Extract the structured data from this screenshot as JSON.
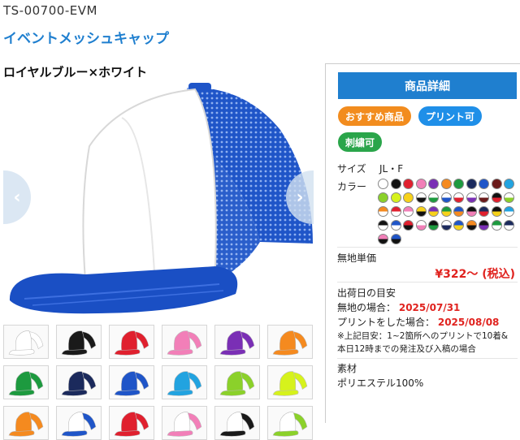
{
  "product": {
    "code": "TS-00700-EVM",
    "name": "イベントメッシュキャップ",
    "variant": "ロイヤルブルー×ホワイト"
  },
  "gallery": {
    "prev_icon": "chevron-left-icon",
    "next_icon": "chevron-right-icon",
    "prev_glyph": "‹",
    "next_glyph": "›",
    "thumbnails": [
      {
        "front": "#ffffff",
        "back": "#ffffff",
        "brim": "#ffffff"
      },
      {
        "front": "#1a1a1a",
        "back": "#1a1a1a",
        "brim": "#1a1a1a"
      },
      {
        "front": "#e0202e",
        "back": "#e0202e",
        "brim": "#e0202e"
      },
      {
        "front": "#f27fb8",
        "back": "#f27fb8",
        "brim": "#f27fb8"
      },
      {
        "front": "#7a2fb5",
        "back": "#7a2fb5",
        "brim": "#7a2fb5"
      },
      {
        "front": "#f58a1f",
        "back": "#f58a1f",
        "brim": "#f58a1f"
      },
      {
        "front": "#1d9a3f",
        "back": "#1d9a3f",
        "brim": "#1d9a3f"
      },
      {
        "front": "#1b2a5c",
        "back": "#1b2a5c",
        "brim": "#1b2a5c"
      },
      {
        "front": "#1f55c8",
        "back": "#1f55c8",
        "brim": "#1f55c8"
      },
      {
        "front": "#22a3e0",
        "back": "#22a3e0",
        "brim": "#22a3e0"
      },
      {
        "front": "#8bd12a",
        "back": "#8bd12a",
        "brim": "#8bd12a"
      },
      {
        "front": "#d6f21c",
        "back": "#d6f21c",
        "brim": "#d6f21c"
      },
      {
        "front": "#f58a1f",
        "back": "#f58a1f",
        "brim": "#f58a1f"
      },
      {
        "front": "#ffffff",
        "back": "#1f55c8",
        "brim": "#1f55c8"
      },
      {
        "front": "#e0202e",
        "back": "#e0202e",
        "brim": "#e0202e"
      },
      {
        "front": "#ffffff",
        "back": "#f27fb8",
        "brim": "#f27fb8"
      },
      {
        "front": "#ffffff",
        "back": "#1a1a1a",
        "brim": "#1a1a1a"
      },
      {
        "front": "#ffffff",
        "back": "#8bd12a",
        "brim": "#8bd12a"
      }
    ]
  },
  "hero": {
    "front": "#ffffff",
    "mesh": "#1f55c8",
    "brim": "#1a4fc4"
  },
  "details": {
    "header": "商品詳細",
    "tags": {
      "recommended": "おすすめ商品",
      "printable": "プリント可",
      "embroidery": "刺繍可"
    },
    "size_label": "サイズ",
    "size_value": "JL・F",
    "color_label": "カラー",
    "colors": [
      [
        "#ffffff",
        "#ffffff"
      ],
      [
        "#111111",
        "#111111"
      ],
      [
        "#e0202e",
        "#e0202e"
      ],
      [
        "#f27fb8",
        "#f27fb8"
      ],
      [
        "#7a2fb5",
        "#7a2fb5"
      ],
      [
        "#f58a1f",
        "#f58a1f"
      ],
      [
        "#1d9a3f",
        "#1d9a3f"
      ],
      [
        "#1b2a5c",
        "#1b2a5c"
      ],
      [
        "#1f55c8",
        "#1f55c8"
      ],
      [
        "#6a1a1a",
        "#6a1a1a"
      ],
      [
        "#22a3e0",
        "#22a3e0"
      ],
      [
        "#8bd12a",
        "#8bd12a"
      ],
      [
        "#d6f21c",
        "#d6f21c"
      ],
      [
        "#f7d21a",
        "#f7d21a"
      ],
      [
        "#ffffff",
        "#111111"
      ],
      [
        "#ffffff",
        "#1d9a3f"
      ],
      [
        "#ffffff",
        "#1f55c8"
      ],
      [
        "#ffffff",
        "#e0202e"
      ],
      [
        "#ffffff",
        "#7a2fb5"
      ],
      [
        "#ffffff",
        "#6a1a1a"
      ],
      [
        "#111111",
        "#e0202e"
      ],
      [
        "#ffffff",
        "#8bd12a"
      ],
      [
        "#f58a1f",
        "#ffffff"
      ],
      [
        "#e0202e",
        "#ffffff"
      ],
      [
        "#f27fb8",
        "#ffffff"
      ],
      [
        "#f7d21a",
        "#111111"
      ],
      [
        "#7a2fb5",
        "#f7d21a"
      ],
      [
        "#1d9a3f",
        "#f7d21a"
      ],
      [
        "#1f55c8",
        "#f58a1f"
      ],
      [
        "#111111",
        "#f27fb8"
      ],
      [
        "#1b2a5c",
        "#e0202e"
      ],
      [
        "#111111",
        "#f7d21a"
      ],
      [
        "#22a3e0",
        "#ffffff"
      ],
      [
        "#111111",
        "#ffffff"
      ],
      [
        "#1f55c8",
        "#ffffff"
      ],
      [
        "#e0202e",
        "#111111"
      ],
      [
        "#ffffff",
        "#f27fb8"
      ],
      [
        "#111111",
        "#1d9a3f"
      ],
      [
        "#ffffff",
        "#1b2a5c"
      ],
      [
        "#1f55c8",
        "#f7d21a"
      ],
      [
        "#f58a1f",
        "#111111"
      ],
      [
        "#111111",
        "#7a2fb5"
      ],
      [
        "#1d9a3f",
        "#ffffff"
      ],
      [
        "#1b2a5c",
        "#ffffff"
      ],
      [
        "#f27fb8",
        "#111111"
      ],
      [
        "#1f55c8",
        "#111111"
      ]
    ],
    "unit_price_label": "無地単価",
    "unit_price": "¥322〜 (税込)",
    "shipping_label": "出荷日の目安",
    "plain_label": "無地の場合：",
    "plain_date": "2025/07/31",
    "print_label": "プリントをした場合：",
    "print_date": "2025/08/08",
    "note": "※上記目安：1~2箇所へのプリントで10着&本日12時までの発注及び入稿の場合",
    "material_label": "素材",
    "material_value": "ポリエステル100%"
  }
}
